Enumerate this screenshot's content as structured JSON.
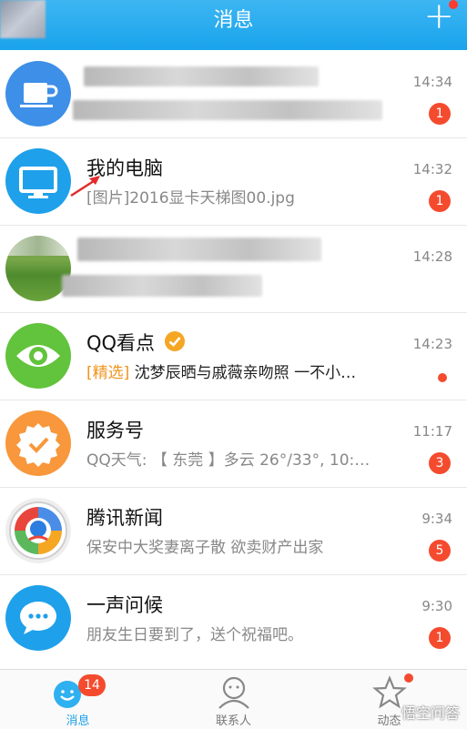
{
  "header": {
    "title": "消息"
  },
  "chats": [
    {
      "title": "",
      "subtitle": "",
      "time": "14:34",
      "badge": "1",
      "icon": "cup-icon"
    },
    {
      "title": "我的电脑",
      "subtitle": "[图片]2016显卡天梯图00.jpg",
      "time": "14:32",
      "badge": "1",
      "icon": "computer-icon"
    },
    {
      "title": "",
      "subtitle": "",
      "time": "14:28",
      "badge": "",
      "icon": "lawn-photo"
    },
    {
      "title": "QQ看点",
      "subtitle_highlight": "[精选]",
      "subtitle": " 沈梦辰晒与戚薇亲吻照 一不小…",
      "time": "14:23",
      "badge": "",
      "icon": "eye-icon"
    },
    {
      "title": "服务号",
      "subtitle": "QQ天气: 【 东莞 】多云 26°/33°, 10:…",
      "time": "11:17",
      "badge": "3",
      "icon": "check-badge-icon"
    },
    {
      "title": "腾讯新闻",
      "subtitle": "保安中大奖妻离子散 欲卖财产出家",
      "time": "9:34",
      "badge": "5",
      "icon": "news-icon"
    },
    {
      "title": "一声问候",
      "subtitle": "朋友生日要到了，送个祝福吧。",
      "time": "9:30",
      "badge": "1",
      "icon": "chat-icon"
    }
  ],
  "tabs": [
    {
      "label": "消息",
      "badge": "14",
      "active": true
    },
    {
      "label": "联系人",
      "badge": ""
    },
    {
      "label": "动态",
      "badge": ""
    }
  ],
  "watermark": "悟空问答",
  "colors": {
    "header": "#1ea7ee",
    "badge": "#f44b2f",
    "highlight": "#f0941d"
  }
}
